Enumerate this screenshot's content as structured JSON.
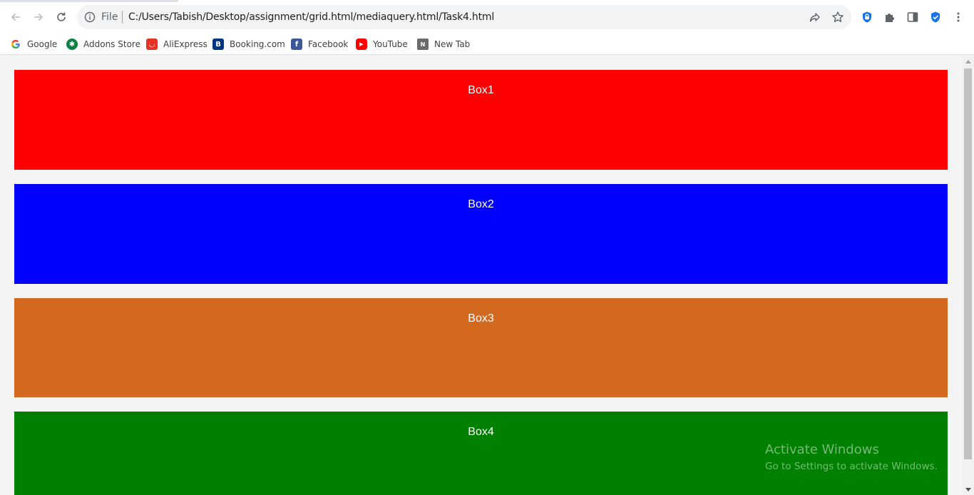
{
  "browser": {
    "address_prefix": "File",
    "url": "C:/Users/Tabish/Desktop/assignment/grid.html/mediaquery.html/Task4.html",
    "icons": [
      "back-arrow-icon",
      "forward-arrow-icon",
      "reload-icon",
      "info-icon",
      "share-icon",
      "star-icon",
      "lock-extension-icon",
      "puzzle-icon",
      "side-panel-icon",
      "shield-check-icon",
      "more-vert-icon"
    ]
  },
  "bookmarks": [
    {
      "label": "Google"
    },
    {
      "label": "Addons Store"
    },
    {
      "label": "AliExpress"
    },
    {
      "label": "Booking.com"
    },
    {
      "label": "Facebook"
    },
    {
      "label": "YouTube"
    },
    {
      "label": "New Tab"
    }
  ],
  "boxes": [
    {
      "label": "Box1",
      "color": "#ff0000"
    },
    {
      "label": "Box2",
      "color": "#0000ff"
    },
    {
      "label": "Box3",
      "color": "#d2691e"
    },
    {
      "label": "Box4",
      "color": "#008000"
    }
  ],
  "watermark": {
    "title": "Activate Windows",
    "subtitle": "Go to Settings to activate Windows."
  }
}
